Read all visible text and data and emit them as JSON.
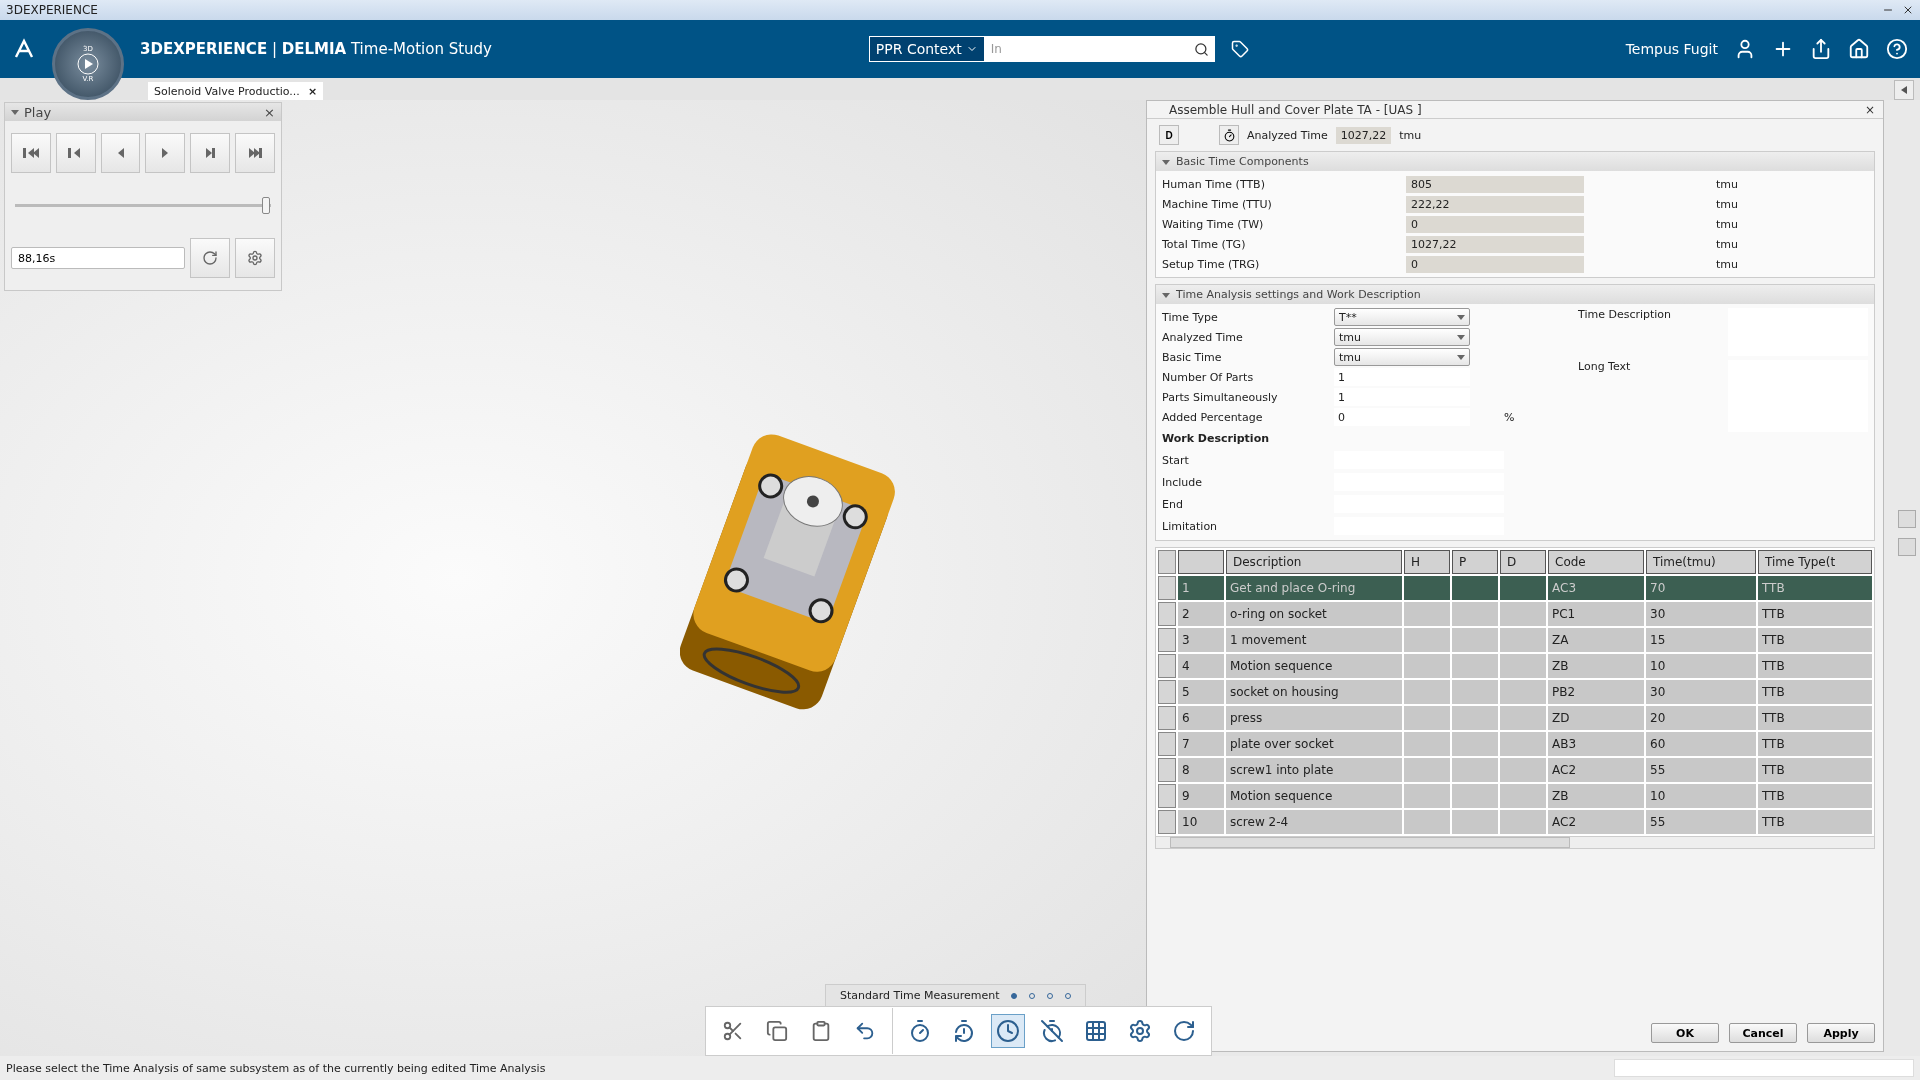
{
  "window": {
    "title": "3DEXPERIENCE"
  },
  "header": {
    "brand": "3DEXPERIENCE",
    "separator": "|",
    "app": "DELMIA",
    "module": "Time-Motion Study",
    "compass_labels": [
      "3D",
      "V.R"
    ],
    "context": "PPR Context",
    "search_placeholder": "In",
    "user": "Tempus Fugit"
  },
  "doc_tabs": [
    {
      "label": "Solenoid Valve Productio...",
      "close": "×",
      "selected": true
    }
  ],
  "play_panel": {
    "title": "Play",
    "close": "×",
    "slider": {
      "level": 0.99
    },
    "time": "88,16s"
  },
  "dialog": {
    "title": "Assemble Hull and Cover Plate TA - [UAS ]",
    "close": "×",
    "doc_button": "D",
    "analyzed_label": "Analyzed Time",
    "analyzed_value": "1027,22",
    "analyzed_unit": "tmu",
    "basic_section": {
      "title": "Basic Time Components",
      "expanded": true,
      "rows": [
        {
          "label": "Human Time (TTB)",
          "value": "805",
          "unit": "tmu"
        },
        {
          "label": "Machine Time (TTU)",
          "value": "222,22",
          "unit": "tmu"
        },
        {
          "label": "Waiting Time (TW)",
          "value": "0",
          "unit": "tmu"
        },
        {
          "label": "Total Time (TG)",
          "value": "1027,22",
          "unit": "tmu"
        },
        {
          "label": "Setup Time (TRG)",
          "value": "0",
          "unit": "tmu"
        }
      ]
    },
    "settings_section": {
      "title": "Time Analysis settings and Work Description",
      "expanded": true,
      "fields": [
        {
          "kind": "select",
          "label": "Time Type",
          "value": "T**"
        },
        {
          "kind": "select",
          "label": "Analyzed Time",
          "value": "tmu"
        },
        {
          "kind": "select",
          "label": "Basic Time",
          "value": "tmu"
        },
        {
          "kind": "input",
          "label": "Number Of Parts",
          "value": "1"
        },
        {
          "kind": "input",
          "label": "Parts Simultaneously",
          "value": "1"
        },
        {
          "kind": "input",
          "label": "Added Percentage",
          "value": "0",
          "unit": "%"
        },
        {
          "kind": "heading",
          "label": "Work Description"
        },
        {
          "kind": "text",
          "label": "Start"
        },
        {
          "kind": "text",
          "label": "Include"
        },
        {
          "kind": "text",
          "label": "End"
        },
        {
          "kind": "text",
          "label": "Limitation"
        }
      ],
      "side_fields": [
        {
          "label": "Time Description"
        },
        {
          "label": "Long Text"
        }
      ]
    },
    "table": {
      "columns": [
        "Description",
        "H",
        "P",
        "D",
        "Code",
        "Time(tmu)",
        "Time Type(t"
      ],
      "rows": [
        {
          "num": "1",
          "description": "Get and place O-ring",
          "code": "AC3",
          "time": "70",
          "type": "TTB",
          "selected": true
        },
        {
          "num": "2",
          "description": "o-ring on socket",
          "code": "PC1",
          "time": "30",
          "type": "TTB",
          "selected": false
        },
        {
          "num": "3",
          "description": "1 movement",
          "code": "ZA",
          "time": "15",
          "type": "TTB",
          "selected": false
        },
        {
          "num": "4",
          "description": "Motion sequence",
          "code": "ZB",
          "time": "10",
          "type": "TTB",
          "selected": false
        },
        {
          "num": "5",
          "description": "socket on housing",
          "code": "PB2",
          "time": "30",
          "type": "TTB",
          "selected": false
        },
        {
          "num": "6",
          "description": "press",
          "code": "ZD",
          "time": "20",
          "type": "TTB",
          "selected": false
        },
        {
          "num": "7",
          "description": "plate over socket",
          "code": "AB3",
          "time": "60",
          "type": "TTB",
          "selected": false
        },
        {
          "num": "8",
          "description": "screw1  into plate",
          "code": "AC2",
          "time": "55",
          "type": "TTB",
          "selected": false
        },
        {
          "num": "9",
          "description": "Motion sequence",
          "code": "ZB",
          "time": "10",
          "type": "TTB",
          "selected": false
        },
        {
          "num": "10",
          "description": "screw 2-4",
          "code": "AC2",
          "time": "55",
          "type": "TTB",
          "selected": false
        }
      ]
    },
    "buttons": [
      "OK",
      "Cancel",
      "Apply"
    ]
  },
  "action_bar": {
    "title": "Standard Time Measurement",
    "pages": [
      {
        "selected": true
      },
      {
        "selected": false
      },
      {
        "selected": false
      },
      {
        "selected": false
      }
    ],
    "tools": [
      {
        "selected": false
      },
      {
        "selected": false
      },
      {
        "selected": true
      },
      {
        "selected": false
      },
      {
        "selected": false
      },
      {
        "selected": false
      },
      {
        "selected": false
      }
    ]
  },
  "status_bar": {
    "message": "Please select the Time Analysis of same subsystem as of the currently being edited Time Analysis"
  }
}
